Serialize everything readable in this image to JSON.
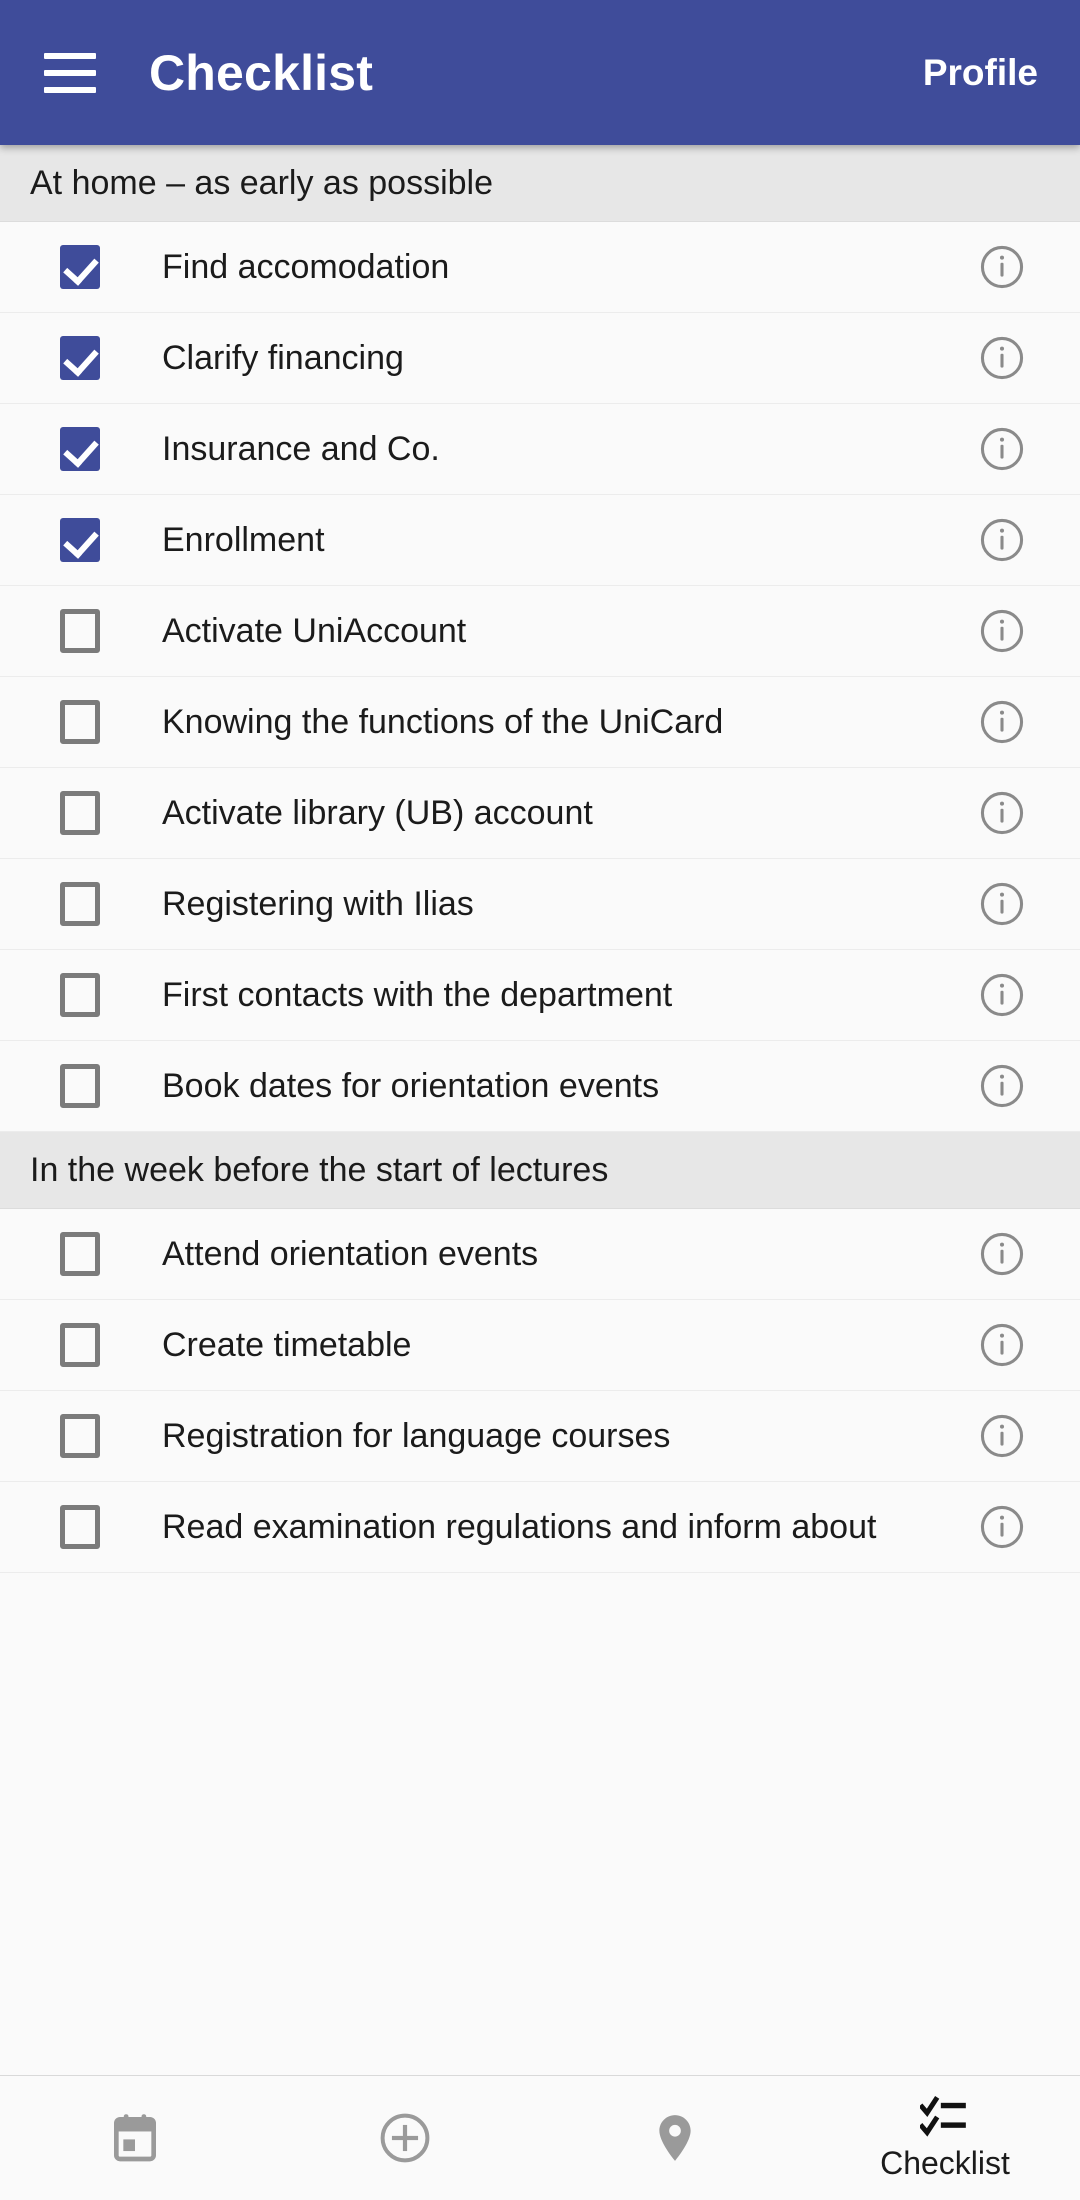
{
  "appbar": {
    "menu_icon": "hamburger-menu-icon",
    "title": "Checklist",
    "action_label": "Profile",
    "background_color": "#3f4c9a",
    "text_color": "#ffffff"
  },
  "theme": {
    "accent_color": "#3f4c9a",
    "section_header_bg": "#e7e7e7",
    "row_bg": "#fafafa",
    "checkbox_off_border": "#7b7b7b",
    "info_icon_color": "#8a8a8a"
  },
  "sections": [
    {
      "title": "At home – as early as possible",
      "items": [
        {
          "label": "Find accomodation",
          "checked": true,
          "info_icon": "info-icon"
        },
        {
          "label": "Clarify financing",
          "checked": true,
          "info_icon": "info-icon"
        },
        {
          "label": "Insurance and Co.",
          "checked": true,
          "info_icon": "info-icon"
        },
        {
          "label": "Enrollment",
          "checked": true,
          "info_icon": "info-icon"
        },
        {
          "label": "Activate UniAccount",
          "checked": false,
          "info_icon": "info-icon"
        },
        {
          "label": "Knowing the functions of the UniCard",
          "checked": false,
          "info_icon": "info-icon"
        },
        {
          "label": "Activate library (UB) account",
          "checked": false,
          "info_icon": "info-icon"
        },
        {
          "label": "Registering with Ilias",
          "checked": false,
          "info_icon": "info-icon"
        },
        {
          "label": "First contacts with the department",
          "checked": false,
          "info_icon": "info-icon"
        },
        {
          "label": "Book dates for orientation events",
          "checked": false,
          "info_icon": "info-icon"
        }
      ]
    },
    {
      "title": "In the week before the start of lectures",
      "items": [
        {
          "label": "Attend orientation events",
          "checked": false,
          "info_icon": "info-icon"
        },
        {
          "label": "Create timetable",
          "checked": false,
          "info_icon": "info-icon"
        },
        {
          "label": "Registration for language courses",
          "checked": false,
          "info_icon": "info-icon"
        },
        {
          "label": "Read examination regulations and inform about",
          "checked": false,
          "info_icon": "info-icon"
        }
      ]
    }
  ],
  "bottomnav": {
    "items": [
      {
        "icon": "calendar-icon",
        "label": "",
        "active": false
      },
      {
        "icon": "plus-circle-icon",
        "label": "",
        "active": false
      },
      {
        "icon": "location-pin-icon",
        "label": "",
        "active": false
      },
      {
        "icon": "checklist-icon",
        "label": "Checklist",
        "active": true
      }
    ]
  }
}
